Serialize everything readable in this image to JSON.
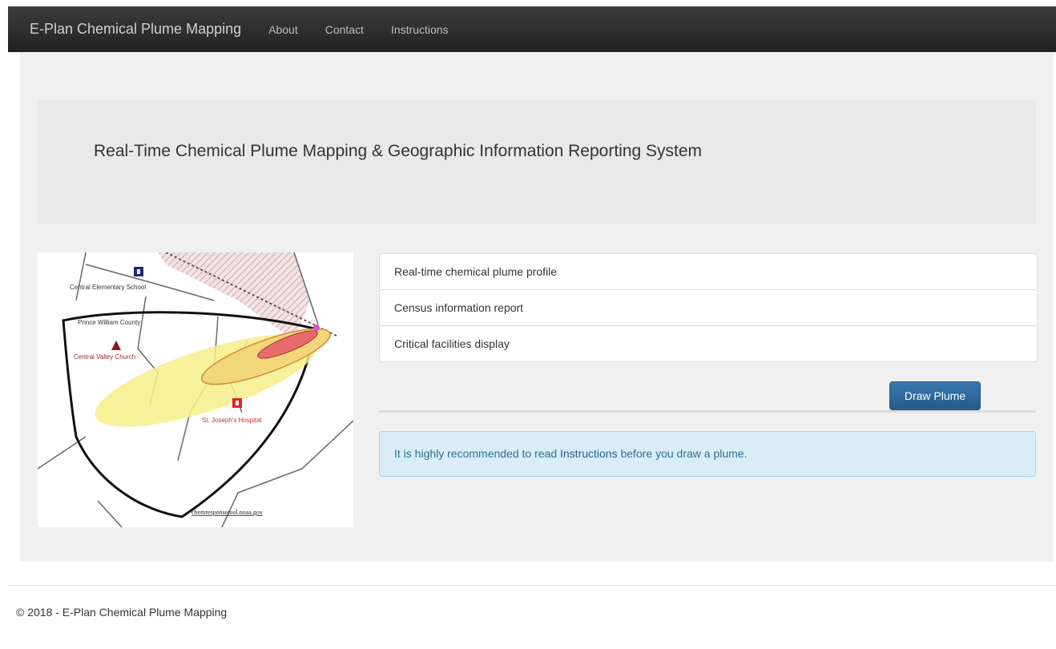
{
  "navbar": {
    "brand": "E-Plan Chemical Plume Mapping",
    "links": [
      "About",
      "Contact",
      "Instructions"
    ]
  },
  "jumbotron": {
    "title": "Real-Time Chemical Plume Mapping & Geographic Information Reporting System"
  },
  "map": {
    "labels": {
      "school": "Central Elementary School",
      "county": "Prince William County",
      "church": "Central Valley Church",
      "hospital": "St. Joseph's Hospital",
      "credit": "chemresponsetool.noaa.gov"
    },
    "colors": {
      "plume_outer": "#f7ef8a",
      "plume_mid": "#e0a14c",
      "plume_inner": "#e45b5b",
      "school_icon": "#1b2a7a",
      "hospital_icon": "#e0262c",
      "church_icon": "#8b1a1a"
    }
  },
  "features": {
    "items": [
      "Real-time chemical plume profile",
      "Census information report",
      "Critical facilities display"
    ]
  },
  "actions": {
    "draw_plume_label": "Draw Plume"
  },
  "alert": {
    "prefix": "It is highly recommended to read ",
    "link": "Instructions",
    "suffix": " before you draw a plume.",
    "background": "#d8edf7"
  },
  "footer": {
    "text": "© 2018 - E-Plan Chemical Plume Mapping"
  }
}
